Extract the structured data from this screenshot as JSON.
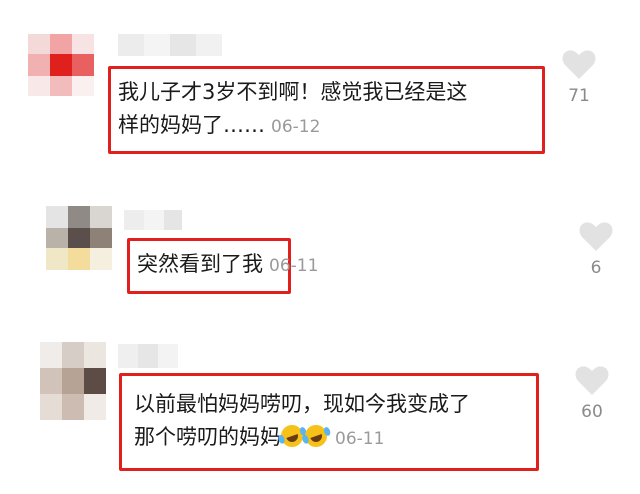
{
  "comments": [
    {
      "text_line1": "我儿子才3岁不到啊！感觉我已经是这",
      "text_line2": "样的妈妈了……",
      "date": "06-12",
      "like_count": "71"
    },
    {
      "text_line1": "突然看到了我",
      "date": "06-11",
      "like_count": "6"
    },
    {
      "text_line1": "以前最怕妈妈唠叨，现如今我变成了",
      "text_line2": "那个唠叨的妈妈",
      "emoji_count": 2,
      "emoji_icon": "rolling-on-floor-laughing-emoji",
      "date": "06-11",
      "like_count": "60"
    }
  ],
  "icons": {
    "like": "heart-icon",
    "like_color": "#e2e2e2"
  },
  "colors": {
    "highlight": "#e0201c",
    "date": "#9a9a9a"
  }
}
